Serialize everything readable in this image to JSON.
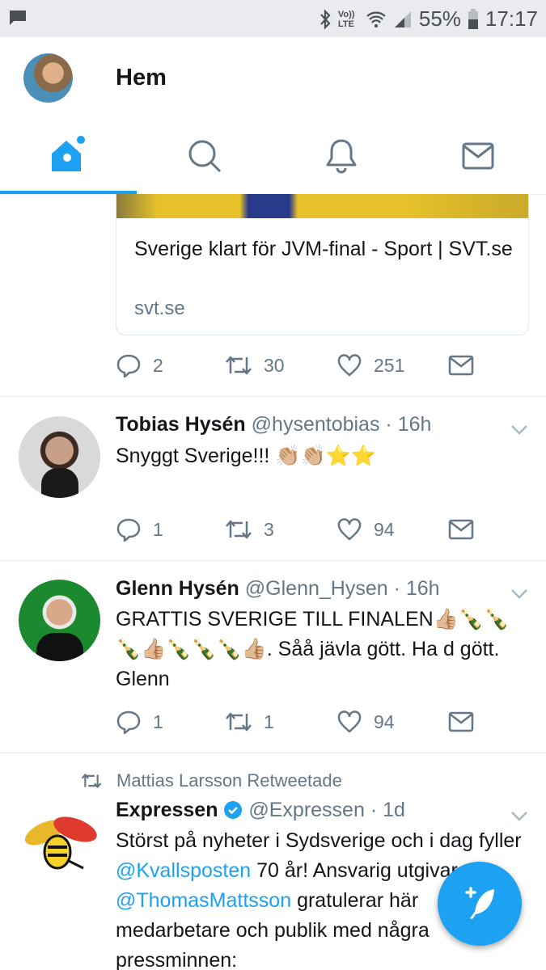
{
  "status_bar": {
    "battery": "55%",
    "time": "17:17",
    "lte_label": "Vo)) LTE",
    "icons": [
      "message-icon",
      "bluetooth-icon",
      "wifi-icon",
      "signal-icon",
      "battery-icon"
    ]
  },
  "header": {
    "title": "Hem"
  },
  "tabs": [
    {
      "name": "home",
      "icon": "home-icon",
      "active": true
    },
    {
      "name": "search",
      "icon": "search-icon",
      "active": false
    },
    {
      "name": "notifications",
      "icon": "bell-icon",
      "active": false
    },
    {
      "name": "messages",
      "icon": "mail-icon",
      "active": false
    }
  ],
  "link_card": {
    "title": "Sverige klart för JVM-final - Sport | SVT.se",
    "domain": "svt.se",
    "replies": "2",
    "retweets": "30",
    "likes": "251"
  },
  "tweets": [
    {
      "name": "Tobias Hysén",
      "handle": "@hysentobias",
      "time": "· 16h",
      "text": "Snyggt Sverige!!! 👏🏼👏🏼⭐⭐",
      "replies": "1",
      "retweets": "3",
      "likes": "94"
    },
    {
      "name": "Glenn Hysén",
      "handle": "@Glenn_Hysen",
      "time": "· 16h",
      "text": "GRATTIS SVERIGE TILL FINALEN👍🏼🍾🍾🍾👍🏼🍾🍾🍾👍🏼.  Såå jävla gött. Ha d gött. Glenn",
      "replies": "1",
      "retweets": "1",
      "likes": "94"
    },
    {
      "retweeted_by": "Mattias Larsson Retweetade",
      "name": "Expressen",
      "handle": "@Expressen",
      "time": "· 1d",
      "text_parts": {
        "t1": "Störst på nyheter i Sydsverige och i dag fyller ",
        "m1": "@Kvallsposten",
        "t2": " 70 år! Ansvarig utgivare ",
        "m2": "@ThomasMattsson",
        "t3": " gratulerar här medarbetare och publik med några pressminnen:"
      }
    }
  ],
  "colors": {
    "accent": "#1da1f2",
    "text": "#14171a",
    "secondary": "#657786",
    "statusbar_bg": "#e9ebee"
  }
}
